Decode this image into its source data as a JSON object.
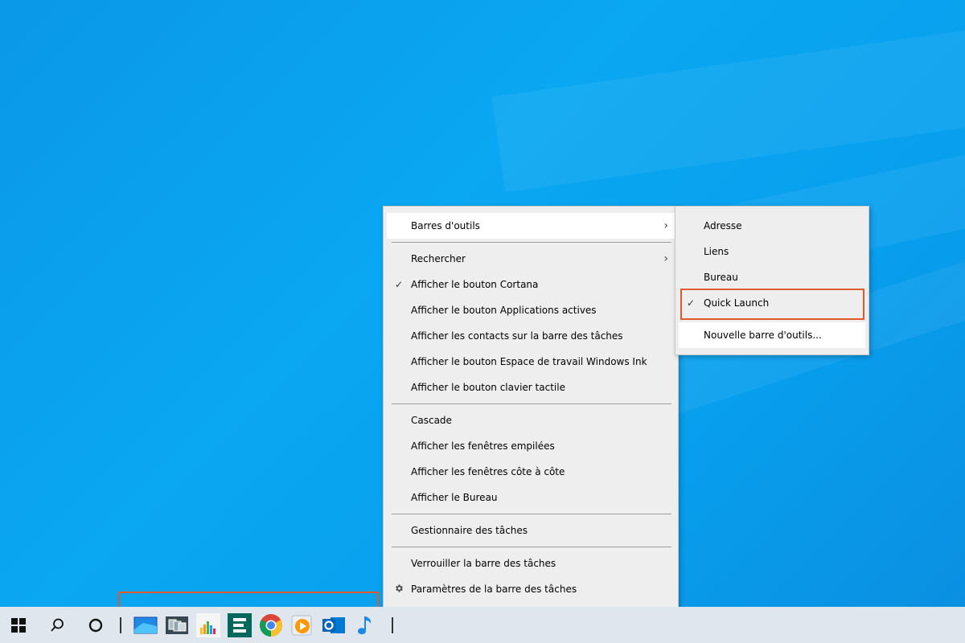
{
  "context_menu": {
    "items": [
      {
        "label": "Barres d'outils",
        "checked": false,
        "submenu": true
      },
      {
        "label": "Rechercher",
        "checked": false,
        "submenu": true
      },
      {
        "label": "Afficher le bouton Cortana",
        "checked": true,
        "submenu": false
      },
      {
        "label": "Afficher le bouton Applications actives",
        "checked": false,
        "submenu": false
      },
      {
        "label": "Afficher les contacts sur la barre des tâches",
        "checked": false,
        "submenu": false
      },
      {
        "label": "Afficher le bouton Espace de travail Windows Ink",
        "checked": false,
        "submenu": false
      },
      {
        "label": "Afficher le bouton clavier tactile",
        "checked": false,
        "submenu": false
      },
      {
        "label": "Cascade",
        "checked": false,
        "submenu": false
      },
      {
        "label": "Afficher les fenêtres empilées",
        "checked": false,
        "submenu": false
      },
      {
        "label": "Afficher les fenêtres côte à côte",
        "checked": false,
        "submenu": false
      },
      {
        "label": "Afficher le Bureau",
        "checked": false,
        "submenu": false
      },
      {
        "label": "Gestionnaire des tâches",
        "checked": false,
        "submenu": false
      },
      {
        "label": "Verrouiller la barre des tâches",
        "checked": false,
        "submenu": false
      },
      {
        "label": "Paramètres de la barre des tâches",
        "checked": false,
        "submenu": false,
        "icon": "gear-icon"
      }
    ]
  },
  "toolbars_submenu": {
    "items": [
      {
        "label": "Adresse",
        "checked": false
      },
      {
        "label": "Liens",
        "checked": false
      },
      {
        "label": "Bureau",
        "checked": false
      },
      {
        "label": "Quick Launch",
        "checked": true
      },
      {
        "label": "Nouvelle barre d'outils...",
        "checked": false
      }
    ]
  },
  "glyphs": {
    "check": "✓",
    "chevron": "›"
  },
  "taskbar": {
    "system_icons": [
      "windows-start-icon",
      "search-icon",
      "cortana-icon"
    ],
    "quick_launch_icons": [
      "show-desktop-icon",
      "switch-windows-icon",
      "audio-equalizer-icon",
      "e-app-icon",
      "chrome-icon",
      "media-player-icon",
      "outlook-icon",
      "music-note-icon"
    ]
  },
  "colors": {
    "accent_highlight": "#e05a2b",
    "desktop_blue": "#0aa7f2",
    "taskbar": "#dfe6ee"
  }
}
